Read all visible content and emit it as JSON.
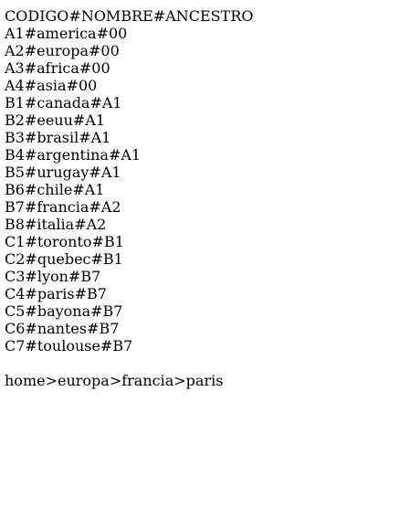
{
  "header": "CODIGO#NOMBRE#ANCESTRO",
  "rows": [
    "A1#america#00",
    "A2#europa#00",
    "A3#africa#00",
    "A4#asia#00",
    "B1#canada#A1",
    "B2#eeuu#A1",
    "B3#brasil#A1",
    "B4#argentina#A1",
    "B5#urugay#A1",
    "B6#chile#A1",
    "B7#francia#A2",
    "B8#italia#A2",
    "C1#toronto#B1",
    "C2#quebec#B1",
    "C3#lyon#B7",
    "C4#paris#B7",
    "C5#bayona#B7",
    "C6#nantes#B7",
    "C7#toulouse#B7"
  ],
  "path": "home>europa>francia>paris"
}
